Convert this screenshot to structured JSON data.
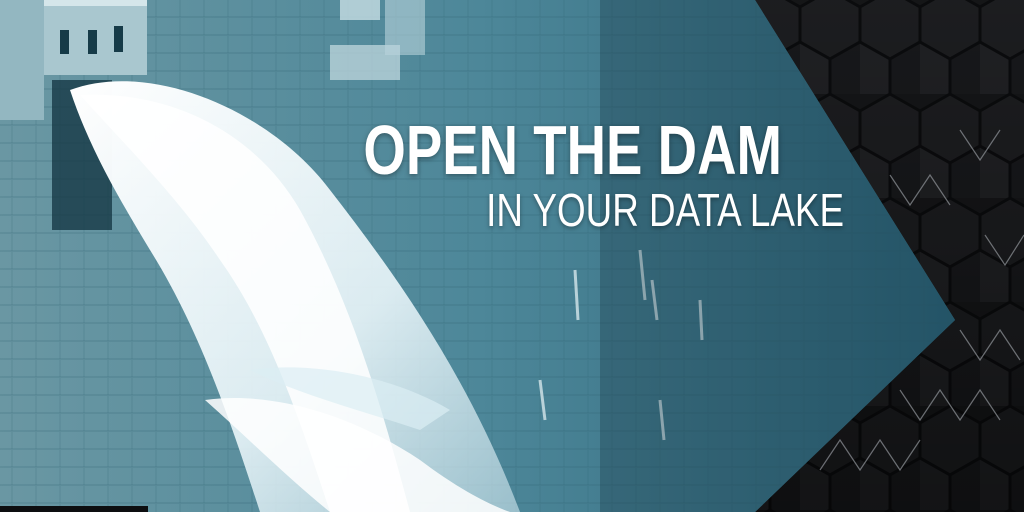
{
  "banner": {
    "headline": "OPEN THE DAM",
    "subheadline": "IN YOUR DATA LAKE"
  },
  "colors": {
    "photo_tint": "#3b7a8f",
    "background": "#17181a",
    "text": "#ffffff"
  },
  "icons": {
    "pattern": "hexagon-pattern-icon"
  }
}
